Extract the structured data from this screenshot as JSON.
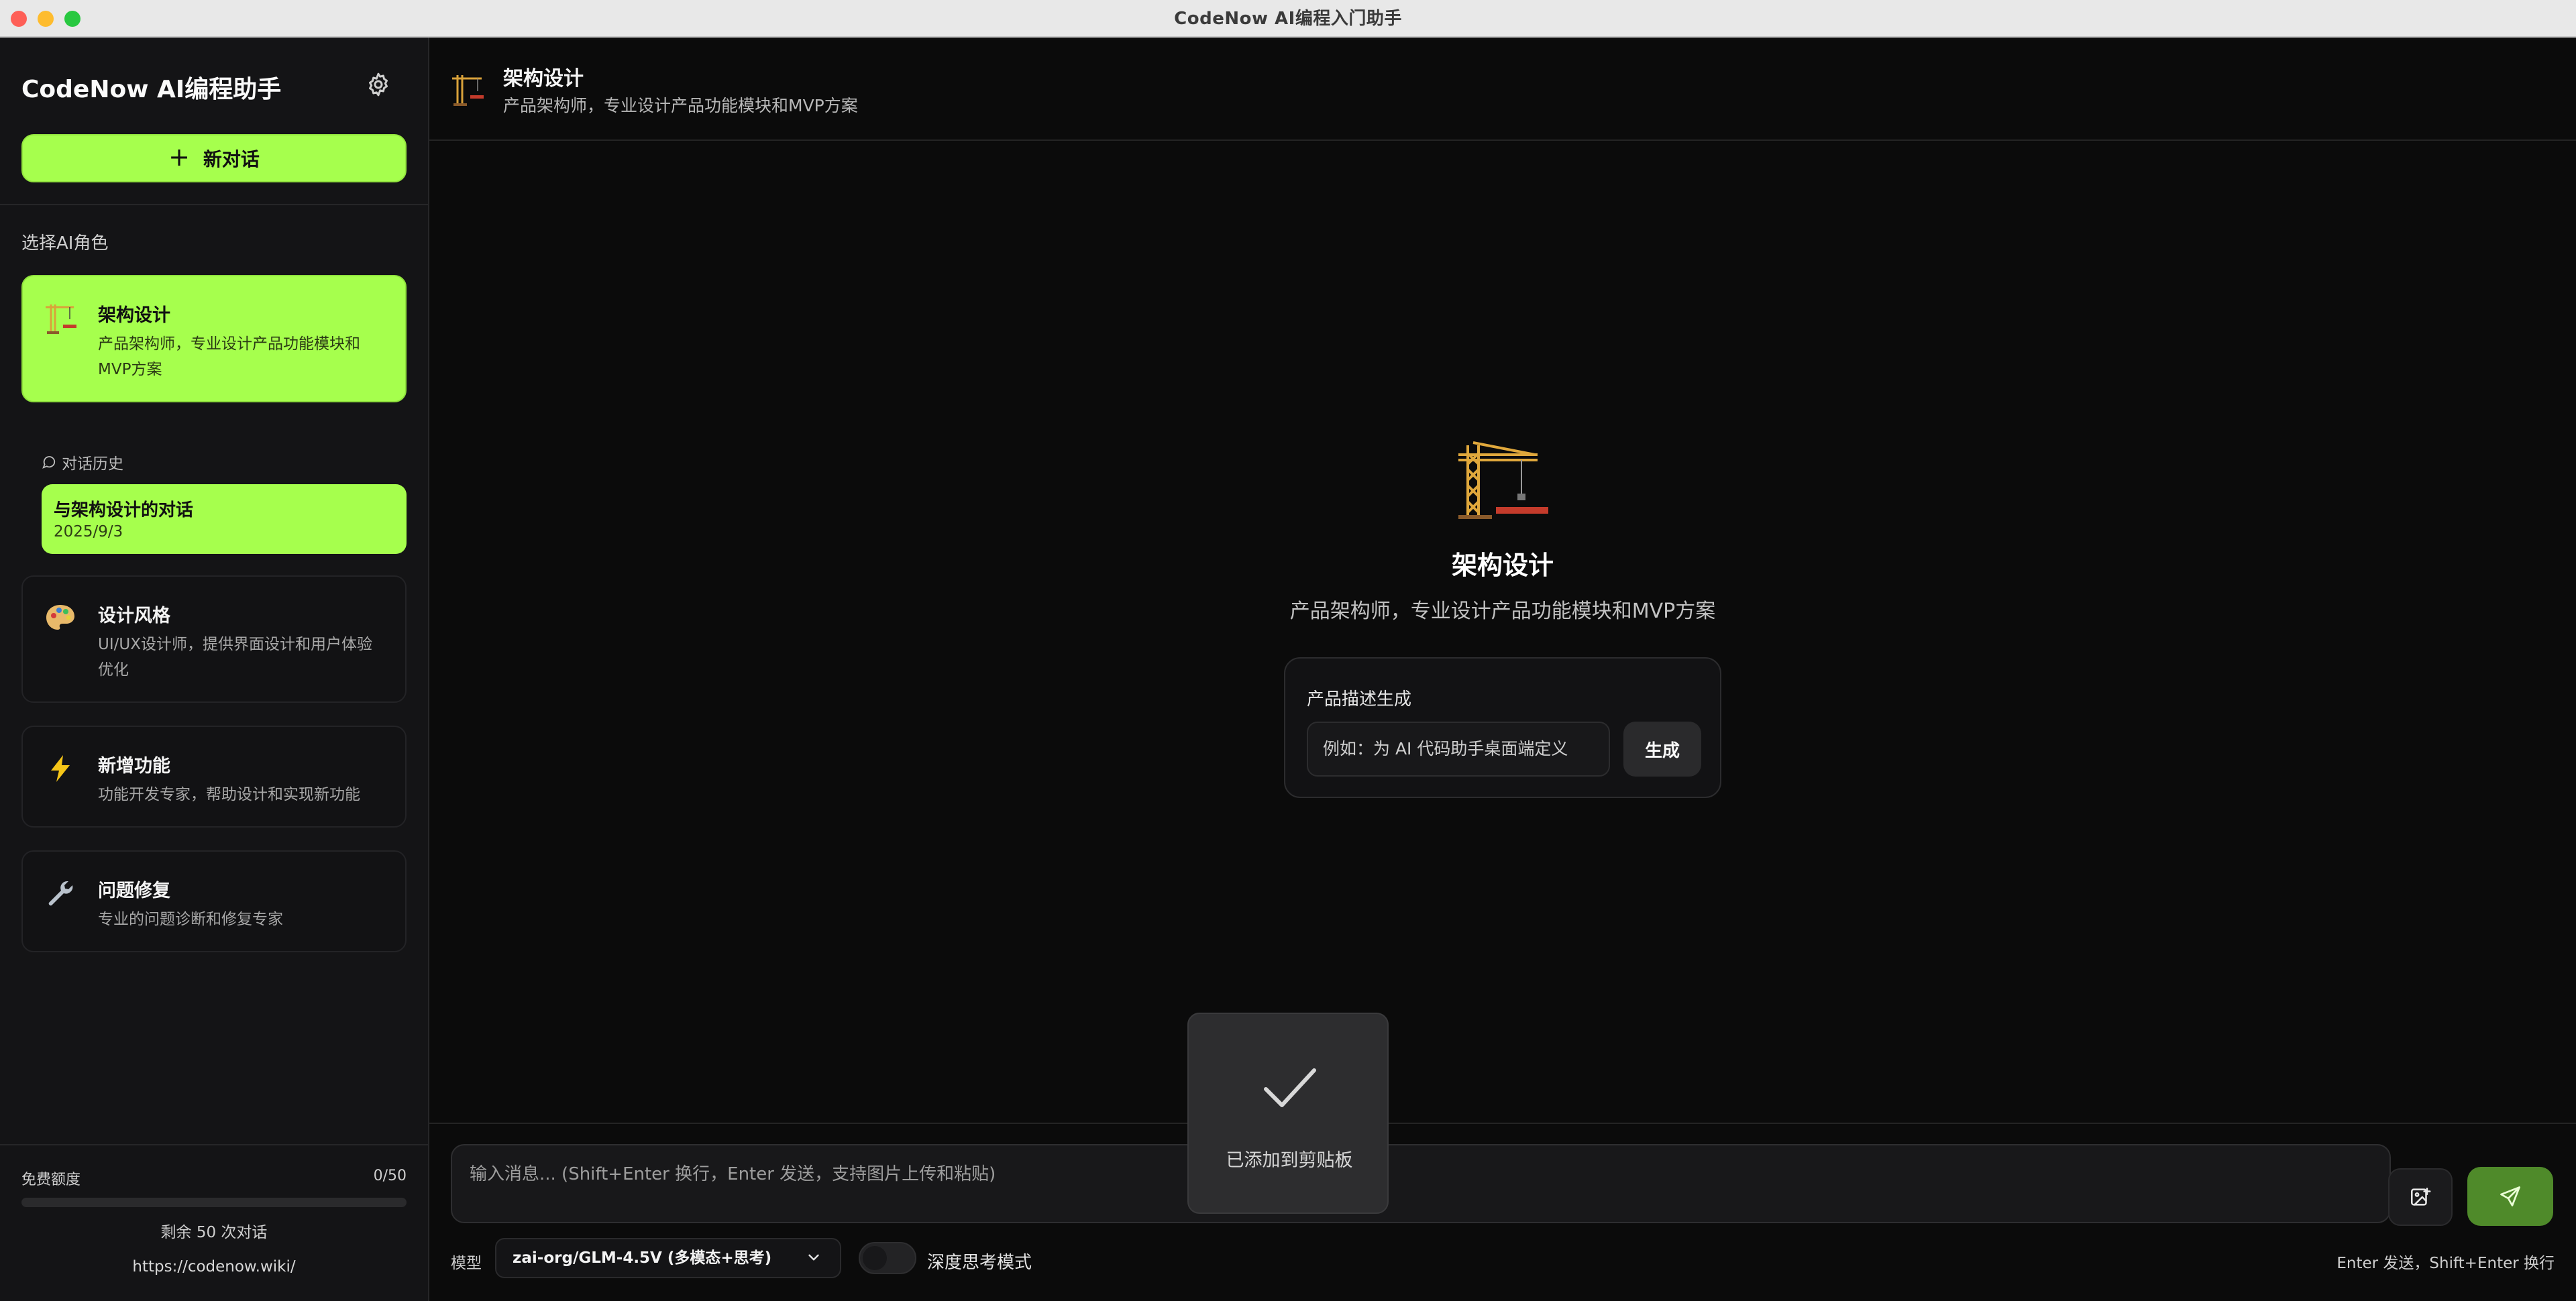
{
  "window": {
    "title": "CodeNow AI编程入门助手"
  },
  "sidebar": {
    "app_title": "CodeNow AI编程助手",
    "new_chat_label": "新对话",
    "section_label": "选择AI角色",
    "roles": [
      {
        "name": "架构设计",
        "desc": "产品架构师，专业设计产品功能模块和MVP方案",
        "icon": "crane-icon",
        "active": true
      },
      {
        "name": "设计风格",
        "desc": "UI/UX设计师，提供界面设计和用户体验优化",
        "icon": "palette-icon",
        "active": false
      },
      {
        "name": "新增功能",
        "desc": "功能开发专家，帮助设计和实现新功能",
        "icon": "lightning-icon",
        "active": false
      },
      {
        "name": "问题修复",
        "desc": "专业的问题诊断和修复专家",
        "icon": "wrench-icon",
        "active": false
      }
    ],
    "history_label": "对话历史",
    "history_items": [
      {
        "title": "与架构设计的对话",
        "date": "2025/9/3"
      }
    ],
    "quota": {
      "label": "免费额度",
      "count": "0/50",
      "used_fraction": 0,
      "remaining": "剩余 50 次对话"
    },
    "site_link": "https://codenow.wiki/"
  },
  "header": {
    "title": "架构设计",
    "subtitle": "产品架构师，专业设计产品功能模块和MVP方案"
  },
  "welcome": {
    "title": "架构设计",
    "subtitle": "产品架构师，专业设计产品功能模块和MVP方案",
    "generator": {
      "label": "产品描述生成",
      "placeholder": "例如：为 AI 代码助手桌面端定义",
      "button_label": "生成"
    }
  },
  "toast": {
    "text": "已添加到剪贴板"
  },
  "composer": {
    "placeholder": "输入消息... (Shift+Enter 换行，Enter 发送，支持图片上传和粘贴)",
    "model_label": "模型",
    "model_value": "zai-org/GLM-4.5V (多模态+思考)",
    "deep_think_label": "深度思考模式",
    "deep_think_on": false,
    "hint": "Enter 发送，Shift+Enter 换行"
  },
  "colors": {
    "accent": "#a6ff4d",
    "send_button": "#4f8a2a",
    "background": "#0b0b0b",
    "sidebar": "#141416"
  }
}
